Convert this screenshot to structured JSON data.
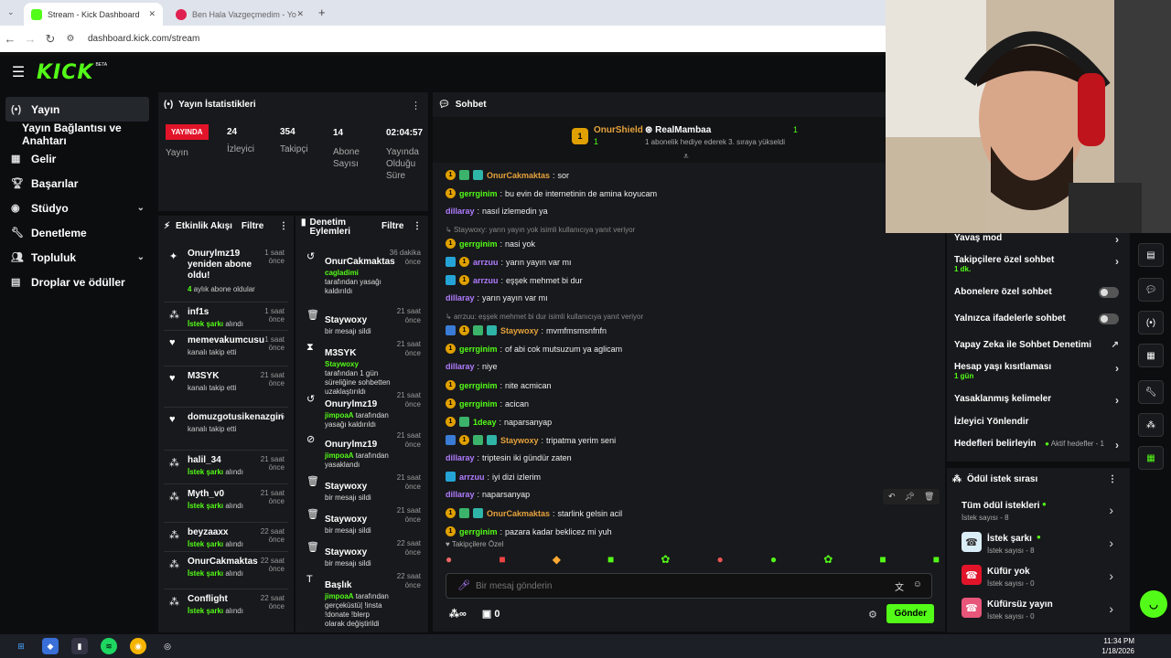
{
  "browser": {
    "tabs": [
      {
        "label": "Stream - Kick Dashboard",
        "active": true
      },
      {
        "label": "Ben Hala Vazgeçmedim - Yo",
        "active": false
      }
    ],
    "url": "dashboard.kick.com/stream"
  },
  "header": {
    "logo": "KICK",
    "beta": "BETA"
  },
  "nav": {
    "items": [
      {
        "label": "Yayın",
        "icon": "live-icon"
      },
      {
        "label": "Yayın Bağlantısı ve Anahtarı",
        "icon": ""
      },
      {
        "label": "Gelir",
        "icon": "revenue-icon"
      },
      {
        "label": "Başarılar",
        "icon": "trophy-icon"
      },
      {
        "label": "Stüdyo",
        "icon": "studio-icon"
      },
      {
        "label": "Denetleme",
        "icon": "wrench-icon"
      },
      {
        "label": "Topluluk",
        "icon": "community-icon"
      },
      {
        "label": "Droplar ve ödüller",
        "icon": "drops-icon"
      }
    ]
  },
  "stats": {
    "title": "Yayın İstatistikleri",
    "live_badge": "YAYINDA",
    "live_label": "Yayın",
    "viewers": {
      "value": "24",
      "label": "İzleyici"
    },
    "followers": {
      "value": "354",
      "label": "Takipçi"
    },
    "subs": {
      "value": "14",
      "label1": "Abone",
      "label2": "Sayısı"
    },
    "uptime": {
      "value": "02:04:57",
      "label1": "Yayında",
      "label2": "Olduğu",
      "label3": "Süre"
    }
  },
  "activity": {
    "title": "Etkinlik Akışı",
    "filter": "Filtre",
    "items": [
      {
        "name": "Onurylmz19 yeniden abone oldu!",
        "time": "1 saat önce",
        "sub_hl": "4",
        "sub": " aylık abone oldular"
      },
      {
        "name": "inf1s",
        "time": "1 saat önce",
        "sub_hl": "İstek şarkı",
        "sub": " alındı"
      },
      {
        "name": "memevakumcusu",
        "time": "1 saat önce",
        "sub_hl": "",
        "sub": "kanalı takip etti"
      },
      {
        "name": "M3SYK",
        "time": "21 saat önce",
        "sub_hl": "",
        "sub": "kanalı takip etti"
      },
      {
        "name": "domuzgotusikenazgin",
        "time": "6",
        "sub_hl": "",
        "sub": "kanalı takip etti"
      },
      {
        "name": "halil_34",
        "time": "21 saat önce",
        "sub_hl": "İstek şarkı",
        "sub": " alındı"
      },
      {
        "name": "Myth_v0",
        "time": "21 saat önce",
        "sub_hl": "İstek şarkı",
        "sub": " alındı"
      },
      {
        "name": "beyzaaxx",
        "time": "22 saat önce",
        "sub_hl": "İstek şarkı",
        "sub": " alındı"
      },
      {
        "name": "OnurCakmaktas",
        "time": "22 saat önce",
        "sub_hl": "İstek şarkı",
        "sub": " alındı"
      },
      {
        "name": "Conflight",
        "time": "22 saat önce",
        "sub_hl": "İstek şarkı",
        "sub": " alındı"
      }
    ]
  },
  "moderation": {
    "title1": "Denetim",
    "title2": "Eylemleri",
    "filter": "Filtre",
    "items": [
      {
        "name": "OnurCakmaktas",
        "time": "36 dakika önce",
        "hl": "cagladimi",
        "sub": " tarafından yasağı kaldırıldı"
      },
      {
        "name": "Staywoxy",
        "time": "21 saat önce",
        "hl": "",
        "sub": "bir mesajı sildi"
      },
      {
        "name": "M3SYK",
        "time": "21 saat önce",
        "hl": "Staywoxy",
        "sub": " tarafından 1 gün süreliğine sohbetten uzaklaştırıldı"
      },
      {
        "name": "Onurylmz19",
        "time": "21 saat önce",
        "hl": "jimpoaA",
        "sub": " tarafından yasağı kaldırıldı"
      },
      {
        "name": "Onurylmz19",
        "time": "21 saat önce",
        "hl": "jimpoaA",
        "sub": " tarafından yasaklandı"
      },
      {
        "name": "Staywoxy",
        "time": "21 saat önce",
        "hl": "",
        "sub": "bir mesajı sildi"
      },
      {
        "name": "Staywoxy",
        "time": "21 saat önce",
        "hl": "",
        "sub": "bir mesajı sildi"
      },
      {
        "name": "Staywoxy",
        "time": "22 saat önce",
        "hl": "",
        "sub": "bir mesajı sildi"
      },
      {
        "name": "Başlık",
        "time": "22 saat önce",
        "hl": "jimpoaA",
        "sub": " tarafından gerçeküstü| !insta !donate !blerp olarak değiştirildi"
      }
    ]
  },
  "chat": {
    "title": "Sohbet",
    "pinned": {
      "top_user": "OnurShield",
      "top_count": "1",
      "gifter": "RealMambaa",
      "gifter_count": "1",
      "gift_text": "1 abonelik hediye ederek 3. sıraya yükseldi"
    },
    "messages": [
      {
        "user": "OnurCakmaktas",
        "color": "#e6a23c",
        "text": "sor",
        "badges": [
          "b",
          "s",
          "g"
        ]
      },
      {
        "user": "gerrginim",
        "color": "#53fc18",
        "text": "bu evin de internetinin de amina koyucam",
        "badges": [
          "b"
        ]
      },
      {
        "user": "dillaray",
        "color": "#b07cff",
        "text": "nasıl izlemedin ya",
        "badges": []
      },
      {
        "user": "gerrginim",
        "color": "#53fc18",
        "text": "nasi yok",
        "badges": [
          "b"
        ],
        "reply": "Staywoxy: yarın yayın yok isimli kullanıcıya yanıt veriyor"
      },
      {
        "user": "arrzuu",
        "color": "#b07cff",
        "text": "yarın yayın var mı",
        "badges": [
          "p",
          "b"
        ]
      },
      {
        "user": "arrzuu",
        "color": "#b07cff",
        "text": "eşşek mehmet bi dur",
        "badges": [
          "p",
          "b"
        ]
      },
      {
        "user": "dillaray",
        "color": "#b07cff",
        "text": "yarın yayın var mı",
        "badges": []
      },
      {
        "user": "Staywoxy",
        "color": "#e6a23c",
        "text": "mvmfmsmsnfnfn",
        "badges": [
          "x",
          "b",
          "s",
          "g"
        ],
        "reply": "arrzuu: eşşek mehmet bi dur isimli kullanıcıya yanıt veriyor"
      },
      {
        "user": "gerrginim",
        "color": "#53fc18",
        "text": "of abi cok mutsuzum ya aglicam",
        "badges": [
          "b"
        ]
      },
      {
        "user": "dillaray",
        "color": "#b07cff",
        "text": "niye",
        "badges": []
      },
      {
        "user": "gerrginim",
        "color": "#53fc18",
        "text": "nite acmican",
        "badges": [
          "b"
        ]
      },
      {
        "user": "gerrginim",
        "color": "#53fc18",
        "text": "acican",
        "badges": [
          "b"
        ]
      },
      {
        "user": "1deay",
        "color": "#53fc18",
        "text": "naparsanyap",
        "badges": [
          "b",
          "s"
        ]
      },
      {
        "user": "Staywoxy",
        "color": "#e6a23c",
        "text": "tripatma yerim seni",
        "badges": [
          "x",
          "b",
          "s",
          "g"
        ]
      },
      {
        "user": "dillaray",
        "color": "#b07cff",
        "text": "triptesin iki gündür zaten",
        "badges": []
      },
      {
        "user": "arrzuu",
        "color": "#b07cff",
        "text": "iyi dizi izlerim",
        "badges": [
          "p"
        ]
      },
      {
        "user": "dillaray",
        "color": "#b07cff",
        "text": "naparsanyap",
        "badges": []
      },
      {
        "user": "OnurCakmaktas",
        "color": "#e6a23c",
        "text": "starlink gelsin acil",
        "badges": [
          "b",
          "s",
          "g"
        ]
      },
      {
        "user": "gerrginim",
        "color": "#53fc18",
        "text": "pazara kadar beklicez mi yuh",
        "badges": [
          "b"
        ]
      }
    ],
    "follower_label": "Takipçilere Özel",
    "input_placeholder": "Bir mesaj gönderin",
    "points": "0",
    "send": "Gönder"
  },
  "settings": {
    "rows": [
      {
        "label": "Yavaş mod",
        "sub": "",
        "ctl": "arrow"
      },
      {
        "label": "Takipçilere özel sohbet",
        "sub": "1 dk.",
        "ctl": "arrow"
      },
      {
        "label": "Abonelere özel sohbet",
        "sub": "",
        "ctl": "toggle"
      },
      {
        "label": "Yalnızca ifadelerle sohbet",
        "sub": "",
        "ctl": "toggle"
      },
      {
        "label": "Yapay Zeka ile Sohbet Denetimi",
        "sub": "",
        "ctl": "ext"
      },
      {
        "label": "Hesap yaşı kısıtlaması",
        "sub": "1 gün",
        "ctl": "arrow"
      },
      {
        "label": "Yasaklanmış kelimeler",
        "sub": "",
        "ctl": "arrow"
      },
      {
        "label": "İzleyici Yönlendir",
        "sub": "",
        "ctl": "none"
      },
      {
        "label": "Hedefleri belirleyin",
        "sub": "",
        "ctl": "arrow",
        "extra": "Aktif hedefler - 1"
      }
    ]
  },
  "reward": {
    "title": "Ödül istek sırası",
    "items": [
      {
        "name": "Tüm ödül istekleri",
        "sub": "İstek sayısı - 8",
        "color": ""
      },
      {
        "name": "İstek şarkı",
        "sub": "İstek sayısı - 8",
        "color": "#d9eef7"
      },
      {
        "name": "Küfür yok",
        "sub": "İstek sayısı - 0",
        "color": "#e2142a"
      },
      {
        "name": "Küfürsüz yayın",
        "sub": "İstek sayısı - 0",
        "color": "#e8567a"
      }
    ]
  },
  "taskbar": {
    "time": "11:34 PM",
    "date": "1/18/2026"
  }
}
